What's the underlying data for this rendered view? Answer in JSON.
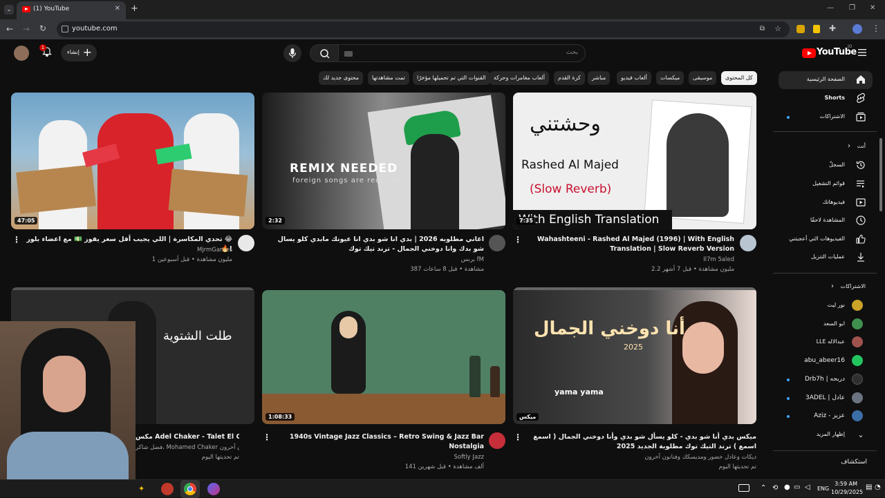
{
  "browser": {
    "tab_title": "(1) YouTube",
    "url": "youtube.com",
    "new_tab": "+",
    "close": "✕"
  },
  "masthead": {
    "logo_text": "YouTube",
    "region": "JO",
    "search_placeholder": "بحث",
    "create_label": "إنشاء",
    "notifications_count": "1"
  },
  "chips": [
    "كل المحتوى",
    "موسيقى",
    "ميكسات",
    "ألعاب فيديو",
    "مباشر",
    "كرة القدم",
    "ألعاب مغامرات وحركة",
    "القنوات التي تم تحميلها مؤخرًا",
    "تمت مشاهدتها",
    "محتوى جديد لك"
  ],
  "sidebar": {
    "main": [
      {
        "label": "الصفحة الرئيسية",
        "icon": "home-icon"
      },
      {
        "label": "Shorts",
        "icon": "shorts-icon"
      },
      {
        "label": "الاشتراكات",
        "icon": "subscriptions-icon"
      }
    ],
    "you_header": "أنت",
    "you": [
      {
        "label": "السجلّ",
        "icon": "history-icon"
      },
      {
        "label": "قوائم التشغيل",
        "icon": "playlists-icon"
      },
      {
        "label": "فيديوهاتك",
        "icon": "your-videos-icon"
      },
      {
        "label": "المشاهدة لاحقًا",
        "icon": "watch-later-icon"
      },
      {
        "label": "الفيديوهات التي أعجبتني",
        "icon": "liked-icon"
      },
      {
        "label": "عمليات التنزيل",
        "icon": "download-icon"
      }
    ],
    "subs_header": "الاشتراكات",
    "subs": [
      {
        "label": "نور ليت",
        "color": "#c9a227"
      },
      {
        "label": "ابو السعد",
        "color": "#3f8f4f"
      },
      {
        "label": "LLE عبدالاله",
        "color": "#a0524c"
      },
      {
        "label": "abu_abeer16",
        "color": "#22c55e"
      },
      {
        "label": "Drb7h | دربحه",
        "color": "#2f2f2f"
      },
      {
        "label": "3ADEL | عادل",
        "color": "#6b7280"
      },
      {
        "label": "Aziz - عزيز",
        "color": "#3b6ea5"
      }
    ],
    "show_more": "إظهار المزيد",
    "explore": "استكشاف"
  },
  "videos": [
    {
      "title": "تحدي المكاسرة | اللي يجيب أقل سعر يفوز 💵 مع اعضاء بلور 😂🔥!",
      "channel": "MjrmGames",
      "meta": "1 مليون مشاهدة • قبل أسبوعين",
      "duration": "47:05"
    },
    {
      "title": "اغاني مطلوبه 2026 | بدي انا شو بدي انا عيونك مابدي كلو يسال شو بدك وانا دوخني الجمال - ترند تيك توك",
      "channel": "برنس fM",
      "meta": "387 مشاهدة • قبل 8 ساعات",
      "duration": "2:32"
    },
    {
      "title": "Wahashteeni - Rashed Al Majed (1996) | With English Translation | Slow Reverb Version",
      "channel": "Il7m 5aled",
      "meta": "2.2 مليون مشاهدة • قبل 7 أشهر",
      "duration": "7:35"
    },
    {
      "title": "مكس Adel Chaker  - Talet El Chatwieh",
      "channel": "فضل شاكر، Mohamed Chaker وفنانون آخرون",
      "meta": "تم تحديثها اليوم",
      "duration": ""
    },
    {
      "title": "1940s Vintage Jazz Classics – Retro Swing & Jazz Bar Nostalgia",
      "channel": "Softly Jazz",
      "meta": "141 ألف مشاهدة • قبل شهرين",
      "duration": "1:08:33"
    },
    {
      "title": "ميكس بدي أنا شو بدي - كلو يسأل شو بدي وأنا دوخني الجمال ( اسمع اسمع ) ترند التيك توك مطلوبة الجديد 2025",
      "channel": "ديكات وعادل خضور ومديسكك وفنانون آخرون",
      "meta": "تم تحديثها اليوم",
      "duration": "ميكس"
    }
  ],
  "thumb_text": {
    "v2_remix": "REMIX NEEDED",
    "v2_sub": "foreign songs are required",
    "v3_arabic": "وحشتني",
    "v3_name": "Rashed Al Majed",
    "v3_slow": "(Slow Reverb)",
    "v3_eng": "With English Translation",
    "v4_arabic": "طلت الشتوية",
    "v6_arabic": "أنا دوخني الجمال",
    "v6_year": "2025",
    "v6_yama": "yama yama"
  },
  "taskbar": {
    "lang": "ENG",
    "time": "3:59 AM",
    "date": "10/29/2025"
  }
}
